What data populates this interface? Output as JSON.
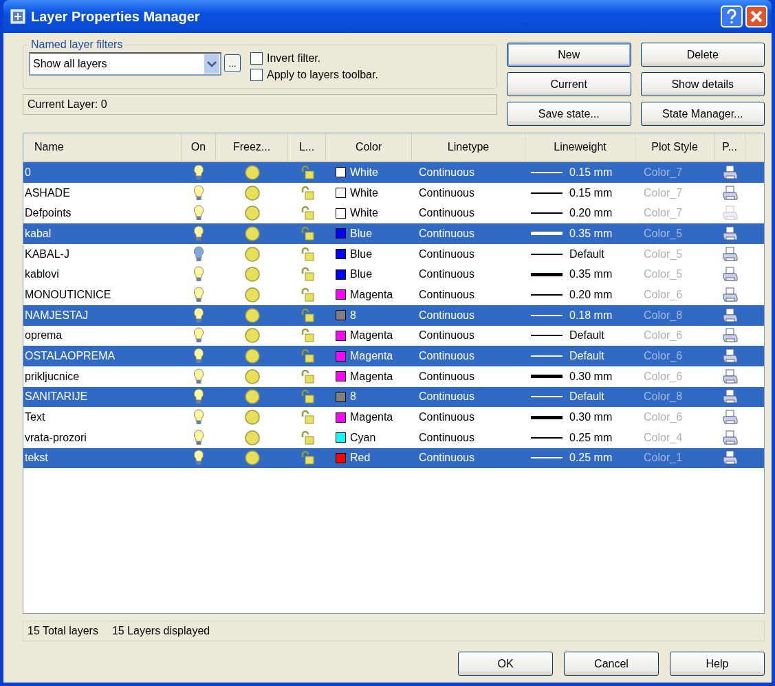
{
  "window": {
    "title": "Layer Properties Manager"
  },
  "filters": {
    "legend": "Named layer filters",
    "value": "Show all layers",
    "browse_label": "...",
    "options": [
      {
        "label": "Invert filter.",
        "checked": false
      },
      {
        "label": "Apply to layers toolbar.",
        "checked": false
      }
    ]
  },
  "current_layer": "Current Layer:  0",
  "buttons": [
    {
      "label": "New",
      "default": true
    },
    {
      "label": "Delete",
      "default": false
    },
    {
      "label": "Current",
      "default": false
    },
    {
      "label": "Show details",
      "default": false
    },
    {
      "label": "Save state...",
      "default": false
    },
    {
      "label": "State Manager...",
      "default": false
    }
  ],
  "table": {
    "columns": [
      "Name",
      "On",
      "Freez...",
      "L...",
      "Color",
      "Linetype",
      "Lineweight",
      "Plot Style",
      "P..."
    ],
    "rows": [
      {
        "name": "0",
        "selected": true,
        "bulb_highlighted": false,
        "color_name": "White",
        "color": "#ffffff",
        "linetype": "Continuous",
        "thick_line": false,
        "lineweight": "0.15 mm",
        "plot_style": "Color_7",
        "plot": true
      },
      {
        "name": "ASHADE",
        "selected": false,
        "bulb_highlighted": false,
        "color_name": "White",
        "color": "#ffffff",
        "linetype": "Continuous",
        "thick_line": false,
        "lineweight": "0.15 mm",
        "plot_style": "Color_7",
        "plot": true
      },
      {
        "name": "Defpoints",
        "selected": false,
        "bulb_highlighted": false,
        "color_name": "White",
        "color": "#ffffff",
        "linetype": "Continuous",
        "thick_line": false,
        "lineweight": "0.20 mm",
        "plot_style": "Color_7",
        "plot": false
      },
      {
        "name": "kabal",
        "selected": true,
        "bulb_highlighted": false,
        "color_name": "Blue",
        "color": "#0000ff",
        "linetype": "Continuous",
        "thick_line": true,
        "lineweight": "0.35 mm",
        "plot_style": "Color_5",
        "plot": true
      },
      {
        "name": "KABAL-J",
        "selected": false,
        "bulb_highlighted": true,
        "color_name": "Blue",
        "color": "#0000ff",
        "linetype": "Continuous",
        "thick_line": false,
        "lineweight": "Default",
        "plot_style": "Color_5",
        "plot": true
      },
      {
        "name": "kablovi",
        "selected": false,
        "bulb_highlighted": false,
        "color_name": "Blue",
        "color": "#0000ff",
        "linetype": "Continuous",
        "thick_line": true,
        "lineweight": "0.35 mm",
        "plot_style": "Color_5",
        "plot": true
      },
      {
        "name": "MONOUTICNICE",
        "selected": false,
        "bulb_highlighted": false,
        "color_name": "Magenta",
        "color": "#ff00ff",
        "linetype": "Continuous",
        "thick_line": false,
        "lineweight": "0.20 mm",
        "plot_style": "Color_6",
        "plot": true
      },
      {
        "name": "NAMJESTAJ",
        "selected": true,
        "bulb_highlighted": false,
        "color_name": "8",
        "color": "#808080",
        "linetype": "Continuous",
        "thick_line": false,
        "lineweight": "0.18 mm",
        "plot_style": "Color_8",
        "plot": true
      },
      {
        "name": "oprema",
        "selected": false,
        "bulb_highlighted": false,
        "color_name": "Magenta",
        "color": "#ff00ff",
        "linetype": "Continuous",
        "thick_line": false,
        "lineweight": "Default",
        "plot_style": "Color_6",
        "plot": true
      },
      {
        "name": "OSTALAOPREMA",
        "selected": true,
        "bulb_highlighted": false,
        "color_name": "Magenta",
        "color": "#ff00ff",
        "linetype": "Continuous",
        "thick_line": false,
        "lineweight": "Default",
        "plot_style": "Color_6",
        "plot": true
      },
      {
        "name": "prikljucnice",
        "selected": false,
        "bulb_highlighted": false,
        "color_name": "Magenta",
        "color": "#ff00ff",
        "linetype": "Continuous",
        "thick_line": true,
        "lineweight": "0.30 mm",
        "plot_style": "Color_6",
        "plot": true
      },
      {
        "name": "SANITARIJE",
        "selected": true,
        "bulb_highlighted": false,
        "color_name": "8",
        "color": "#808080",
        "linetype": "Continuous",
        "thick_line": false,
        "lineweight": "Default",
        "plot_style": "Color_8",
        "plot": true
      },
      {
        "name": "Text",
        "selected": false,
        "bulb_highlighted": false,
        "color_name": "Magenta",
        "color": "#ff00ff",
        "linetype": "Continuous",
        "thick_line": true,
        "lineweight": "0.30 mm",
        "plot_style": "Color_6",
        "plot": true
      },
      {
        "name": "vrata-prozori",
        "selected": false,
        "bulb_highlighted": false,
        "color_name": "Cyan",
        "color": "#00ffff",
        "linetype": "Continuous",
        "thick_line": false,
        "lineweight": "0.25 mm",
        "plot_style": "Color_4",
        "plot": true
      },
      {
        "name": "tekst",
        "selected": true,
        "bulb_highlighted": false,
        "color_name": "Red",
        "color": "#ff0000",
        "linetype": "Continuous",
        "thick_line": false,
        "lineweight": "0.25 mm",
        "plot_style": "Color_1",
        "plot": true
      }
    ]
  },
  "status_bar": [
    "15 Total layers",
    "15 Layers displayed"
  ],
  "footer_buttons": [
    "OK",
    "Cancel",
    "Help"
  ]
}
